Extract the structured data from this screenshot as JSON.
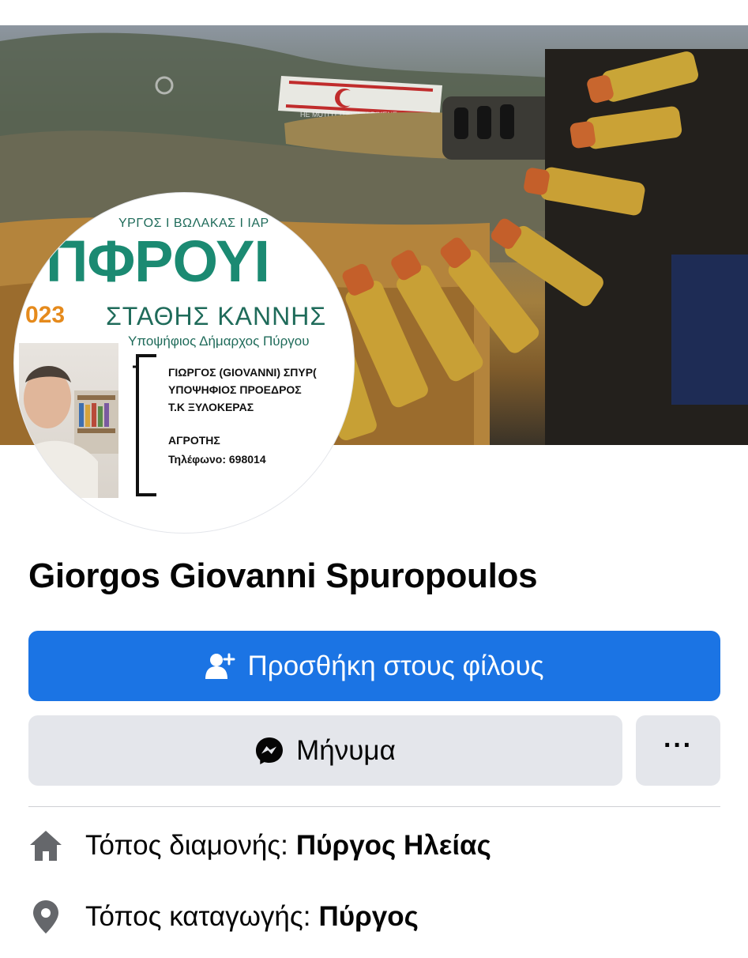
{
  "cover": {
    "flag_text": "HE MUTLU TURKUM DIYENE"
  },
  "avatar": {
    "top_line": "ΥΡΓΟΣ Ι ΒΩΛΑΚΑΣ Ι ΙΑΡ",
    "brand": "ΠΦΡΟΥΙ",
    "year_fragment": "023",
    "candidate_name": "ΣΤΑΘΗΣ ΚΑΝΝΗΣ",
    "candidate_title": "Υποψήφιος Δήμαρχος Πύργου",
    "card": {
      "name": "ΓΙΩΡΓΟΣ (GIOVANNI)  ΣΠΥΡ(",
      "role": "ΥΠΟΨΗΦΙΟΣ ΠΡΟΕΔΡΟΣ",
      "community": "Τ.Κ ΞΥΛΟΚΕΡΑΣ",
      "occupation": "ΑΓΡΟΤΗΣ",
      "phone": "Τηλέφωνο: 698014"
    }
  },
  "profile": {
    "name": "Giorgos Giovanni Spuropoulos"
  },
  "actions": {
    "add_friend": {
      "label": "Προσθήκη στους φίλους",
      "icon": "add-friend-icon"
    },
    "message": {
      "label": "Μήνυμα",
      "icon": "messenger-icon"
    },
    "more": {
      "label": "···",
      "icon": "more-dots-icon"
    }
  },
  "intro": {
    "residence": {
      "label": "Τόπος διαμονής:",
      "value": "Πύργος Ηλείας",
      "icon": "home-icon"
    },
    "origin": {
      "label": "Τόπος καταγωγής:",
      "value": "Πύργος",
      "icon": "location-pin-icon"
    }
  },
  "colors": {
    "primary": "#1b74e4",
    "secondary_button": "#e4e6eb",
    "text": "#050505",
    "icon": "#65676b"
  }
}
